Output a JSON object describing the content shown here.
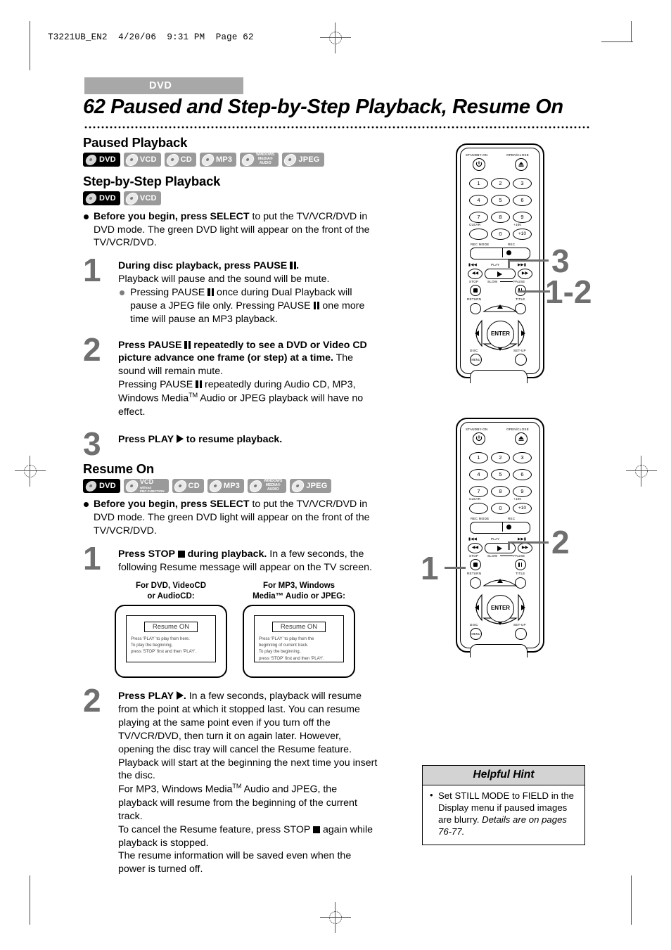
{
  "meta": {
    "file_header": "T3221UB_EN2  4/20/06  9:31 PM  Page 62"
  },
  "header": {
    "tab_label": "DVD",
    "page_number": "62",
    "title": "62  Paused and Step-by-Step Playback, Resume On"
  },
  "sections": {
    "paused_playback": {
      "heading": "Paused Playback",
      "badges": [
        {
          "label": "DVD",
          "active": true
        },
        {
          "label": "VCD",
          "active": false
        },
        {
          "label": "CD",
          "active": false
        },
        {
          "label": "MP3",
          "active": false
        },
        {
          "label": "WINDOWS MEDIA AUDIO",
          "l1": "WINDOWS",
          "l2": "MEDIA®",
          "l3": "AUDIO",
          "active": false
        },
        {
          "label": "JPEG",
          "active": false
        }
      ]
    },
    "step_by_step": {
      "heading": "Step-by-Step Playback",
      "badges": [
        {
          "label": "DVD",
          "active": true
        },
        {
          "label": "VCD",
          "active": false
        }
      ],
      "before": {
        "bold1": "Before you begin, press SELECT",
        "rest": " to put the TV/VCR/DVD in DVD mode.  The green DVD light will appear on the front of the TV/VCR/DVD."
      },
      "steps": [
        {
          "num": "1",
          "lead_a": "During disc playback, press PAUSE ",
          "lead_b": ".",
          "body": "Playback will pause and the sound will be mute.",
          "sub_a": "Pressing PAUSE ",
          "sub_b": " once during Dual Playback will pause a JPEG file only. Pressing PAUSE ",
          "sub_c": " one more time will pause an MP3 playback."
        },
        {
          "num": "2",
          "lead_a": "Press PAUSE ",
          "lead_b": " repeatedly to see a DVD or Video CD picture advance one frame (or step) at a time.",
          "lead_tail": " The sound will remain mute.",
          "body_a": "Pressing PAUSE ",
          "body_b": " repeatedly during Audio CD, MP3, Windows Media",
          "body_tm": "TM",
          "body_c": " Audio or JPEG playback will have no effect."
        },
        {
          "num": "3",
          "lead_a": "Press PLAY ",
          "lead_b": " to resume playback."
        }
      ]
    },
    "resume_on": {
      "heading": "Resume On",
      "badges": [
        {
          "label": "DVD",
          "active": true
        },
        {
          "label": "VCD",
          "sub1": "without",
          "sub2": "PBC FUNCTION",
          "active": false
        },
        {
          "label": "CD",
          "active": false
        },
        {
          "label": "MP3",
          "active": false
        },
        {
          "label": "WINDOWS MEDIA AUDIO",
          "l1": "WINDOWS",
          "l2": "MEDIA®",
          "l3": "AUDIO",
          "active": false
        },
        {
          "label": "JPEG",
          "active": false
        }
      ],
      "before": {
        "bold1": "Before you begin, press SELECT",
        "rest": " to put the TV/VCR/DVD in DVD mode.  The green DVD light will appear on the front of the TV/VCR/DVD."
      },
      "step1": {
        "num": "1",
        "lead_a": "Press STOP ",
        "lead_b": " during playback.",
        "lead_tail": "  In a few seconds, the following Resume message will appear on the TV screen."
      },
      "tv_screens": [
        {
          "caption_l1": "For DVD, VideoCD",
          "caption_l2": "or AudioCD:",
          "resume_label": "Resume ON",
          "message_l1": "Press 'PLAY' to play from here.",
          "message_l2": "To play the beginning,",
          "message_l3": "press 'STOP' first and then 'PLAY'."
        },
        {
          "caption_l1": "For MP3, Windows",
          "caption_l2": "Media™ Audio or JPEG:",
          "resume_label": "Resume ON",
          "message_l1": "Press 'PLAY' to play from the",
          "message_l2": "beginning of current track.",
          "message_l3": "To play the beginning,",
          "message_l4": "press 'STOP' first and then 'PLAY'."
        }
      ],
      "step2": {
        "num": "2",
        "lead_a": "Press PLAY ",
        "lead_b": ".",
        "p1": " In a few seconds, playback will resume from the point at which it stopped last. You can resume playing at the same point even if you turn off the TV/VCR/DVD, then turn it on again later. However, opening the disc tray will cancel the Resume feature. Playback will start at the beginning the next time you insert the disc.",
        "p2_a": "For MP3, Windows Media",
        "p2_tm": "TM",
        "p2_b": " Audio and JPEG, the playback will resume from the beginning of the current track.",
        "p3_a": "To cancel the Resume feature, press STOP ",
        "p3_b": " again while playback is stopped.",
        "p4": "The resume information will be saved even when the power is turned off."
      }
    }
  },
  "helpful_hint": {
    "title": "Helpful Hint",
    "text_plain": "Set STILL MODE to FIELD in the Display menu if paused images are blurry. ",
    "text_italic": "Details are on pages 76-77."
  },
  "remote": {
    "labels": {
      "standby": "STANDBY-ON",
      "open_close": "OPEN/CLOSE",
      "clear": "CLEAR",
      "plus100": "+100",
      "plus10": "+10",
      "rec_mode": "REC MODE",
      "rec": "REC",
      "play": "PLAY",
      "stop": "STOP",
      "slow": "SLOW",
      "pause": "PAUSE",
      "return": "RETURN",
      "title": "TITLE",
      "enter": "ENTER",
      "disc": "DISC",
      "disc_menu": "MENU",
      "setup": "SET-UP",
      "skip_prev": "◀◀",
      "skip_next": "▶▶"
    },
    "numbers": [
      "1",
      "2",
      "3",
      "4",
      "5",
      "6",
      "7",
      "8",
      "9",
      "0"
    ]
  },
  "callouts": {
    "remote1": [
      {
        "text": "3",
        "target": "play-button"
      },
      {
        "text": "1-2",
        "target": "pause-button"
      }
    ],
    "remote2": [
      {
        "text": "1",
        "target": "stop-button"
      },
      {
        "text": "2",
        "target": "play-button"
      }
    ]
  }
}
